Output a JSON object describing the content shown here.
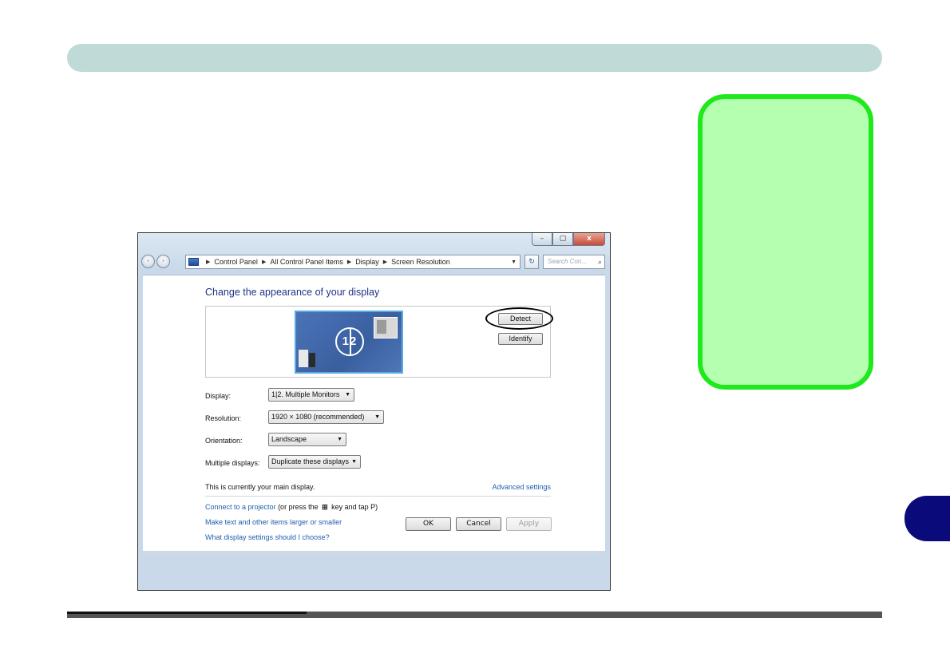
{
  "window": {
    "title_buttons": {
      "minimize": "–",
      "maximize": "▢",
      "close": "x"
    },
    "nav": {
      "back": "‹",
      "forward": "›"
    },
    "breadcrumb": [
      "Control Panel",
      "All Control Panel Items",
      "Display",
      "Screen Resolution"
    ],
    "refresh_icon": "↻",
    "search_placeholder": "Search Con...",
    "search_icon": "⌕"
  },
  "content": {
    "title": "Change the appearance of your display",
    "monitor_label": "12",
    "detect_label": "Detect",
    "identify_label": "Identify",
    "fields": [
      {
        "label": "Display:",
        "value": "1|2. Multiple Monitors"
      },
      {
        "label": "Resolution:",
        "value": "1920 × 1080 (recommended)"
      },
      {
        "label": "Orientation:",
        "value": "Landscape"
      },
      {
        "label": "Multiple displays:",
        "value": "Duplicate these displays"
      }
    ],
    "main_display_text": "This is currently your main display.",
    "advanced_link": "Advanced settings",
    "projector_link": "Connect to a projector",
    "projector_note_a": " (or press the ",
    "projector_note_b": " key and tap P)",
    "text_size_link": "Make text and other items larger or smaller",
    "settings_help_link": "What display settings should I choose?",
    "ok_label": "OK",
    "cancel_label": "Cancel",
    "apply_label": "Apply"
  },
  "colors": {
    "header_bar": "#bfdad7",
    "note_fill": "#b5ffb0",
    "note_border": "#1fe81b",
    "chapter_tab": "#0a0a7a",
    "link": "#1f5fb0"
  }
}
